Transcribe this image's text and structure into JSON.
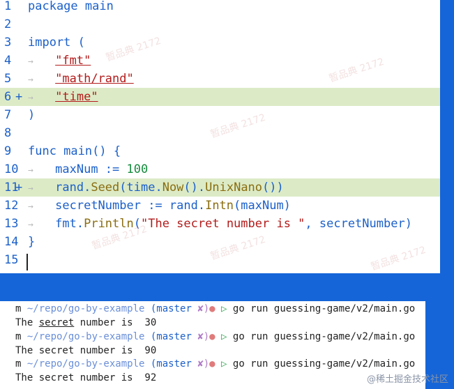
{
  "editor": {
    "lines": [
      {
        "n": "1",
        "mark": "",
        "added": false,
        "indent": false,
        "tokens": [
          {
            "t": "package main",
            "c": "kw"
          }
        ]
      },
      {
        "n": "2",
        "mark": "",
        "added": false,
        "indent": false,
        "tokens": []
      },
      {
        "n": "3",
        "mark": "",
        "added": false,
        "indent": false,
        "tokens": [
          {
            "t": "import (",
            "c": "kw"
          }
        ]
      },
      {
        "n": "4",
        "mark": "",
        "added": false,
        "indent": true,
        "tokens": [
          {
            "t": "\"fmt\"",
            "c": "str"
          }
        ]
      },
      {
        "n": "5",
        "mark": "",
        "added": false,
        "indent": true,
        "tokens": [
          {
            "t": "\"math/rand\"",
            "c": "str"
          }
        ]
      },
      {
        "n": "6",
        "mark": "+",
        "added": true,
        "indent": true,
        "tokens": [
          {
            "t": "\"time\"",
            "c": "str"
          }
        ]
      },
      {
        "n": "7",
        "mark": "",
        "added": false,
        "indent": false,
        "tokens": [
          {
            "t": ")",
            "c": "kw"
          }
        ]
      },
      {
        "n": "8",
        "mark": "",
        "added": false,
        "indent": false,
        "tokens": []
      },
      {
        "n": "9",
        "mark": "",
        "added": false,
        "indent": false,
        "tokens": [
          {
            "t": "func main() {",
            "c": "kw"
          }
        ]
      },
      {
        "n": "10",
        "mark": "",
        "added": false,
        "indent": true,
        "tokens": [
          {
            "t": "maxNum := ",
            "c": "plain"
          },
          {
            "t": "100",
            "c": "num"
          }
        ]
      },
      {
        "n": "11",
        "mark": "+",
        "added": true,
        "indent": true,
        "tokens": [
          {
            "t": "rand.",
            "c": "plain"
          },
          {
            "t": "Seed",
            "c": "fn"
          },
          {
            "t": "(time.",
            "c": "plain"
          },
          {
            "t": "Now",
            "c": "fn"
          },
          {
            "t": "().",
            "c": "plain"
          },
          {
            "t": "UnixNano",
            "c": "fn"
          },
          {
            "t": "())",
            "c": "plain"
          }
        ]
      },
      {
        "n": "12",
        "mark": "",
        "added": false,
        "indent": true,
        "tokens": [
          {
            "t": "secretNumber := rand.",
            "c": "plain"
          },
          {
            "t": "Intn",
            "c": "fn"
          },
          {
            "t": "(maxNum)",
            "c": "plain"
          }
        ]
      },
      {
        "n": "13",
        "mark": "",
        "added": false,
        "indent": true,
        "tokens": [
          {
            "t": "fmt.",
            "c": "plain"
          },
          {
            "t": "Println",
            "c": "fn"
          },
          {
            "t": "(",
            "c": "plain"
          },
          {
            "t": "\"The secret number is \"",
            "c": "str-plain"
          },
          {
            "t": ", secretNumber)",
            "c": "plain"
          }
        ]
      },
      {
        "n": "14",
        "mark": "",
        "added": false,
        "indent": false,
        "tokens": [
          {
            "t": "}",
            "c": "kw"
          }
        ]
      },
      {
        "n": "15",
        "mark": "",
        "added": false,
        "indent": false,
        "tokens": []
      }
    ],
    "tab_glyph": "→",
    "watermark_text": "暂品典 2172"
  },
  "terminal": {
    "prompt_char": "m",
    "path": "~/repo/go-by-example",
    "branch": "(master",
    "dirty": "✘)",
    "dot": "●",
    "tri": "▷",
    "command": "go run guessing-game/v2/main.go",
    "outputs": [
      {
        "prefix": "The ",
        "underlined": "secret",
        "rest": " number is  30"
      },
      {
        "prefix": "The secret number is  90",
        "underlined": "",
        "rest": ""
      },
      {
        "prefix": "The secret number is  92",
        "underlined": "",
        "rest": ""
      }
    ]
  },
  "corner_watermark": "@稀土掘金技术社区"
}
